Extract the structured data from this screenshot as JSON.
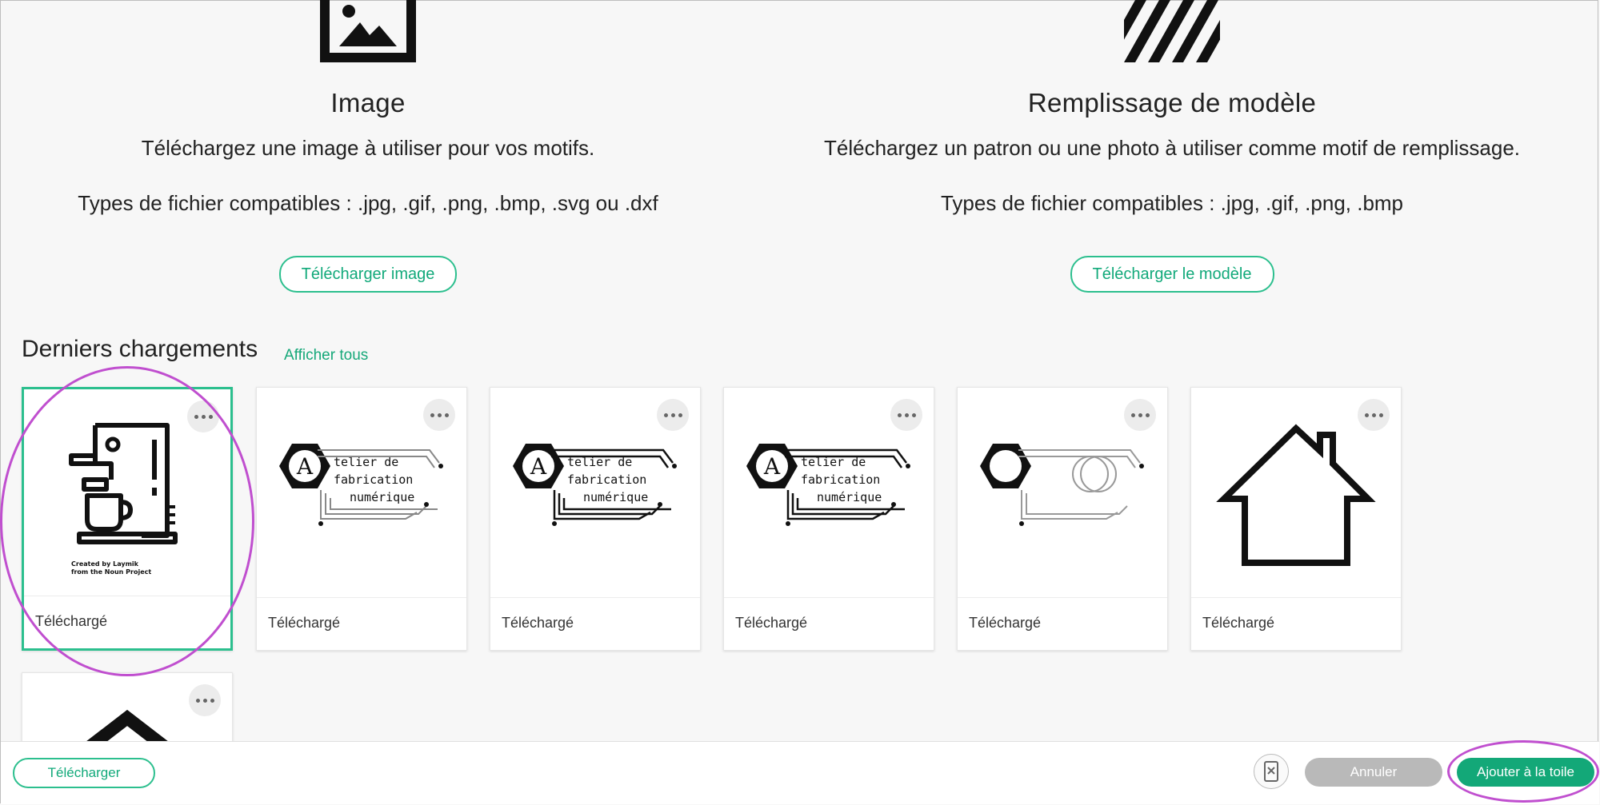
{
  "upload_options": {
    "image": {
      "title": "Image",
      "description": "Téléchargez une image à utiliser pour vos motifs.",
      "types": "Types de fichier compatibles : .jpg, .gif, .png, .bmp, .svg ou .dxf",
      "button": "Télécharger image",
      "icon": "image-icon"
    },
    "pattern": {
      "title": "Remplissage de modèle",
      "description": "Téléchargez un patron ou une photo à utiliser comme motif de remplissage.",
      "types": "Types de fichier compatibles : .jpg, .gif, .png, .bmp",
      "button": "Télécharger le modèle",
      "icon": "pattern-stripes-icon"
    }
  },
  "recent": {
    "title": "Derniers chargements",
    "show_all": "Afficher tous",
    "items": [
      {
        "label": "Téléchargé",
        "thumb": "coffee-machine",
        "caption_lines": [
          "Created by Laymik",
          "from the Noun Project"
        ],
        "selected": true
      },
      {
        "label": "Téléchargé",
        "thumb": "atelier-logo",
        "logo_text": [
          "telier de",
          "fabrication",
          "numérique"
        ],
        "logo_letter": "A"
      },
      {
        "label": "Téléchargé",
        "thumb": "atelier-logo",
        "logo_text": [
          "telier de",
          "fabrication",
          "numérique"
        ],
        "logo_letter": "A"
      },
      {
        "label": "Téléchargé",
        "thumb": "atelier-logo",
        "logo_text": [
          "telier de",
          "fabrication",
          "numérique"
        ],
        "logo_letter": "A"
      },
      {
        "label": "Téléchargé",
        "thumb": "hexagon-circuit"
      },
      {
        "label": "Téléchargé",
        "thumb": "house"
      },
      {
        "label": "",
        "thumb": "partial-roof"
      }
    ]
  },
  "bottom_bar": {
    "upload": "Télécharger",
    "cancel": "Annuler",
    "add_to_canvas": "Ajouter à la toile"
  },
  "colors": {
    "accent": "#13a878",
    "accent_border": "#2cbf8e",
    "annotation": "#c04fcf",
    "disabled": "#b9b9b9"
  }
}
